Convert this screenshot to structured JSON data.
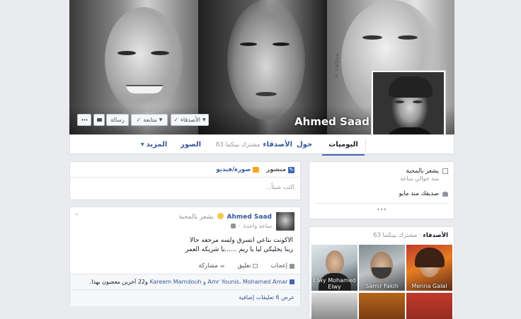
{
  "profile": {
    "name": "Ahmed Saad",
    "cover_watermark": "H. IraQiya"
  },
  "cover_buttons": {
    "friends": "الأصدقاء",
    "following": "متابعة",
    "message": "رسالة"
  },
  "nav": {
    "timeline": "اليوميات",
    "about": "حول",
    "friends": "الأصدقاء",
    "friends_mutual": "مشترك بينكما 63",
    "photos": "الصور",
    "more": "المزيد"
  },
  "activity": {
    "feeling_text": "يشعر بالمحبة",
    "feeling_time": "منذ حوالي ساعة",
    "friend_since": "صديقك منذ مايو",
    "more_dots": "•••"
  },
  "composer": {
    "status_tab": "منشور",
    "photo_tab": "صورة/فيديو",
    "placeholder": "اكتب شيئاً..."
  },
  "post": {
    "author": "Ahmed Saad",
    "feeling": "يشعر بالمحبة",
    "time": "ساعة واحدة",
    "text_line1": "الاكونت بتاعي انسرق ولسه مرجعه حالا",
    "text_line2": "ربنا يخليكي ليا يا ريم ......يا شريكه العمر",
    "like": "إعجاب",
    "comment": "تعليق",
    "share": "مشاركة",
    "likes_summary_names": "Amr Younis، Mohamed Amar و Kareem Mamdouh",
    "likes_summary_rest": "و22 آخرين معجبون بهذا.",
    "view_more_comments": "عرض 6 تعليقات إضافية"
  },
  "friends_box": {
    "title": "الأصدقاء",
    "mutual": "مشترك بينكما 63",
    "items": [
      {
        "name": "Menna Galal"
      },
      {
        "name": "Samir Fakih"
      },
      {
        "name": "Elwy Mohamed Elwy"
      }
    ]
  },
  "colors": {
    "link_blue": "#365899",
    "page_bg": "#e9ebee",
    "border": "#dddfe2"
  }
}
